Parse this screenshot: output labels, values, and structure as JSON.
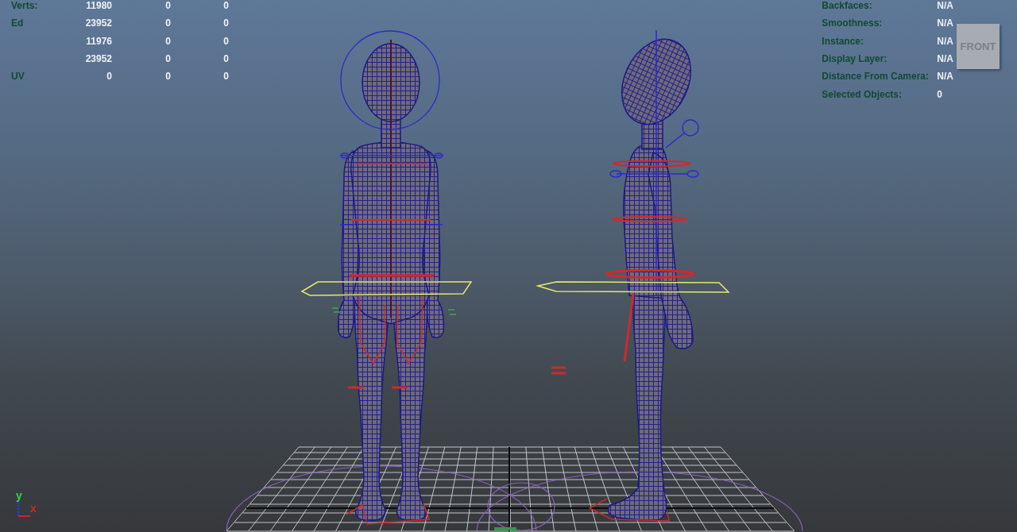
{
  "viewport": {
    "stats": {
      "rows": [
        {
          "label": "Verts:",
          "values": [
            "11980",
            "0",
            "0"
          ]
        },
        {
          "label": "Ed",
          "values": [
            "23952",
            "0",
            "0"
          ]
        },
        {
          "values": [
            "11976",
            "0",
            "0"
          ]
        },
        {
          "values": [
            "23952",
            "0",
            "0"
          ]
        },
        {
          "label": "UV",
          "values": [
            "0",
            "0",
            "0"
          ]
        }
      ]
    },
    "info": {
      "rows": [
        {
          "label": "Backfaces:",
          "value": "N/A"
        },
        {
          "label": "Smoothness:",
          "value": "N/A"
        },
        {
          "label": "Instance:",
          "value": "N/A"
        },
        {
          "label": "Display Layer:",
          "value": "N/A"
        },
        {
          "label": "Distance From Camera:",
          "value": "N/A"
        },
        {
          "label": "Selected Objects:",
          "value": "0"
        }
      ]
    },
    "view_cube": {
      "label": "FRONT"
    },
    "axis_indicator": {
      "y_label": "y",
      "x_label": "x"
    }
  }
}
